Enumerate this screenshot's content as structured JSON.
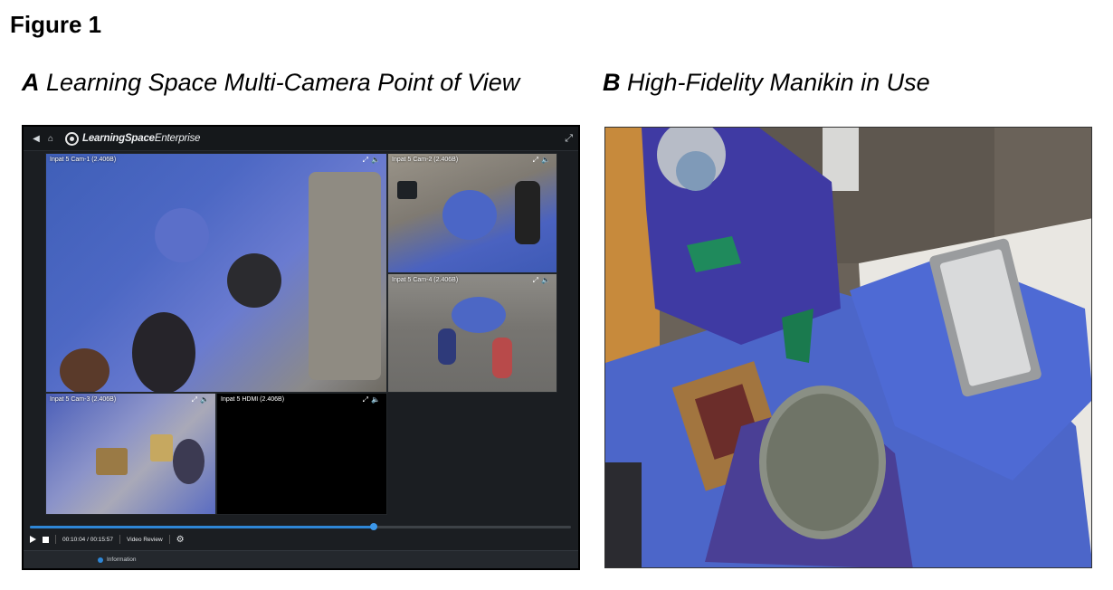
{
  "figure": {
    "title": "Figure 1"
  },
  "panel_a": {
    "letter": "A",
    "caption": "Learning Space Multi-Camera Point of View",
    "app": {
      "brand_bold": "LearningSpace",
      "brand_regular": "Enterprise",
      "cameras": [
        {
          "label": "Inpat 5 Cam-1 (2.406B)"
        },
        {
          "label": "Inpat 5 Cam-2 (2.406B)"
        },
        {
          "label": "Inpat 5 Cam-4 (2.406B)"
        },
        {
          "label": "Inpat 5 Cam-3 (2.406B)"
        },
        {
          "label": "Inpat 5 HDMI (2.406B)"
        }
      ],
      "playback": {
        "progress_fraction": 0.636,
        "time": "00:10:04 / 00:15:57",
        "mode": "Video Review"
      },
      "info_label": "Information"
    }
  },
  "panel_b": {
    "letter": "B",
    "caption": "High-Fidelity Manikin in Use"
  },
  "colors": {
    "accent": "#2e86d6",
    "app_bg": "#1b1e22",
    "drape": "#4a63c9",
    "scrub": "#4743a8"
  },
  "icons": [
    "back-icon",
    "home-icon",
    "logo-icon",
    "expand-icon",
    "mute-icon",
    "play-icon",
    "stop-icon",
    "settings-icon",
    "info-icon"
  ]
}
